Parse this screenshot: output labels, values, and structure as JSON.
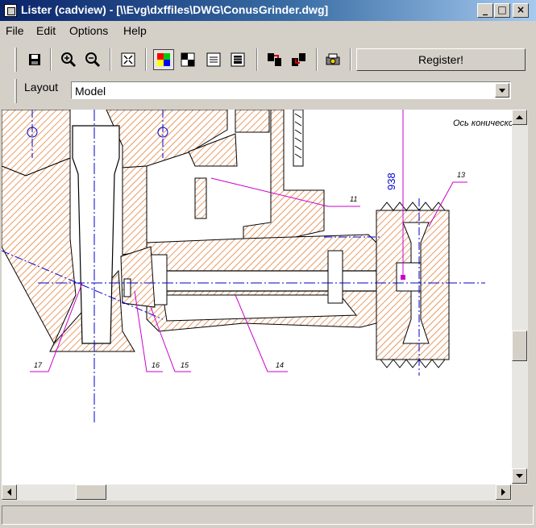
{
  "window": {
    "title": "Lister (cadview) - [\\\\Evg\\dxffiles\\DWG\\ConusGrinder.dwg]"
  },
  "menu": [
    "File",
    "Edit",
    "Options",
    "Help"
  ],
  "toolbar": {
    "register_label": "Register!"
  },
  "layout": {
    "label": "Layout",
    "value": "Model"
  },
  "drawing": {
    "dimension_text": "938",
    "corner_annotation": "Ось конического",
    "callouts": [
      "11",
      "13",
      "14",
      "15",
      "16",
      "17"
    ]
  },
  "colors": {
    "hatch": "#e07a30",
    "centerline": "#0000cc",
    "leader": "#cc00cc",
    "outline": "#000000"
  }
}
